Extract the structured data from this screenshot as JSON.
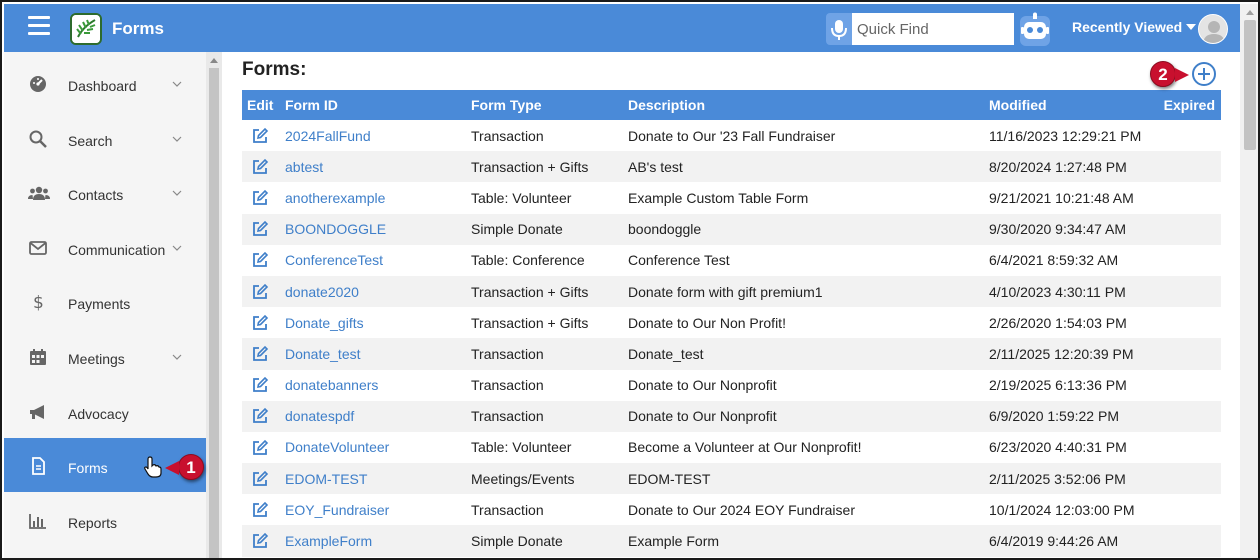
{
  "header": {
    "app_title": "Forms",
    "quick_find_placeholder": "Quick Find",
    "recently_viewed_label": "Recently Viewed",
    "bar_color": "#4a8ad8"
  },
  "sidebar": {
    "items": [
      {
        "label": "Dashboard",
        "icon": "dashboard-icon",
        "has_submenu": true
      },
      {
        "label": "Search",
        "icon": "search-icon",
        "has_submenu": true
      },
      {
        "label": "Contacts",
        "icon": "contacts-icon",
        "has_submenu": true
      },
      {
        "label": "Communication",
        "icon": "envelope-icon",
        "has_submenu": true
      },
      {
        "label": "Payments",
        "icon": "dollar-icon",
        "has_submenu": false
      },
      {
        "label": "Meetings",
        "icon": "calendar-icon",
        "has_submenu": true
      },
      {
        "label": "Advocacy",
        "icon": "megaphone-icon",
        "has_submenu": false
      },
      {
        "label": "Forms",
        "icon": "document-icon",
        "has_submenu": false,
        "active": true
      },
      {
        "label": "Reports",
        "icon": "bar-chart-icon",
        "has_submenu": false
      }
    ]
  },
  "main": {
    "title": "Forms:",
    "callouts": [
      "1",
      "2"
    ],
    "table": {
      "columns": [
        "Edit",
        "Form ID",
        "Form Type",
        "Description",
        "Modified",
        "Expired"
      ],
      "rows": [
        {
          "id": "2024FallFund",
          "type": "Transaction",
          "description": "Donate to Our '23 Fall Fundraiser",
          "modified": "11/16/2023 12:29:21 PM"
        },
        {
          "id": "abtest",
          "type": "Transaction + Gifts",
          "description": "AB's test",
          "modified": "8/20/2024 1:27:48 PM"
        },
        {
          "id": "anotherexample",
          "type": "Table: Volunteer",
          "description": "Example Custom Table Form",
          "modified": "9/21/2021 10:21:48 AM"
        },
        {
          "id": "BOONDOGGLE",
          "type": "Simple Donate",
          "description": "boondoggle",
          "modified": "9/30/2020 9:34:47 AM"
        },
        {
          "id": "ConferenceTest",
          "type": "Table: Conference",
          "description": "Conference Test",
          "modified": "6/4/2021 8:59:32 AM"
        },
        {
          "id": "donate2020",
          "type": "Transaction + Gifts",
          "description": "Donate form with gift premium1",
          "modified": "4/10/2023 4:30:11 PM"
        },
        {
          "id": "Donate_gifts",
          "type": "Transaction + Gifts",
          "description": "Donate to Our Non Profit!",
          "modified": "2/26/2020 1:54:03 PM"
        },
        {
          "id": "Donate_test",
          "type": "Transaction",
          "description": "Donate_test",
          "modified": "2/11/2025 12:20:39 PM"
        },
        {
          "id": "donatebanners",
          "type": "Transaction",
          "description": "Donate to Our Nonprofit",
          "modified": "2/19/2025 6:13:36 PM"
        },
        {
          "id": "donatespdf",
          "type": "Transaction",
          "description": "Donate to Our Nonprofit",
          "modified": "6/9/2020 1:59:22 PM"
        },
        {
          "id": "DonateVolunteer",
          "type": "Table: Volunteer",
          "description": "Become a Volunteer at Our Nonprofit!",
          "modified": "6/23/2020 4:40:31 PM"
        },
        {
          "id": "EDOM-TEST",
          "type": "Meetings/Events",
          "description": "EDOM-TEST",
          "modified": "2/11/2025 3:52:06 PM"
        },
        {
          "id": "EOY_Fundraiser",
          "type": "Transaction",
          "description": "Donate to Our 2024 EOY Fundraiser",
          "modified": "10/1/2024 12:03:00 PM"
        },
        {
          "id": "ExampleForm",
          "type": "Simple Donate",
          "description": "Example Form",
          "modified": "6/4/2019 9:44:26 AM"
        }
      ]
    }
  }
}
